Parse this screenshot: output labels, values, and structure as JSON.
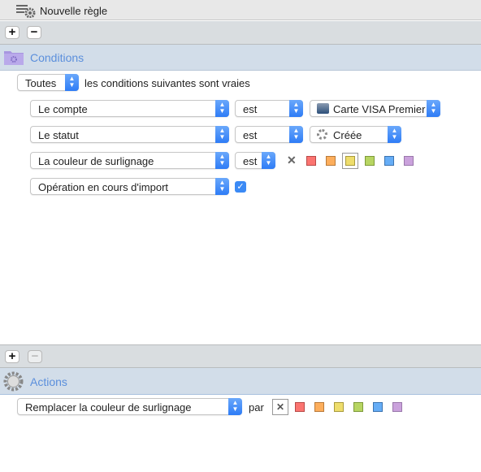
{
  "title": "Nouvelle règle",
  "conditions": {
    "header": "Conditions",
    "match_value": "Toutes",
    "match_suffix": "les conditions suivantes sont vraies",
    "rows": [
      {
        "field": "Le compte",
        "operator": "est",
        "value": "Carte VISA Premier"
      },
      {
        "field": "Le statut",
        "operator": "est",
        "value": "Créée"
      },
      {
        "field": "La couleur de surlignage",
        "operator": "est",
        "selected_color": "yellow"
      },
      {
        "field": "Opération en cours d'import",
        "checked": true
      }
    ]
  },
  "actions": {
    "header": "Actions",
    "action": "Remplacer la couleur de surlignage",
    "by_label": "par",
    "selected_color": "none"
  },
  "colors": {
    "red": "#fb7470",
    "orange": "#fdae5c",
    "yellow": "#eedd6c",
    "green": "#b7d562",
    "blue": "#66adf6",
    "purple": "#caa2dc",
    "accent": "#5b8fdc"
  },
  "buttons": {
    "add": "+",
    "remove": "−"
  }
}
